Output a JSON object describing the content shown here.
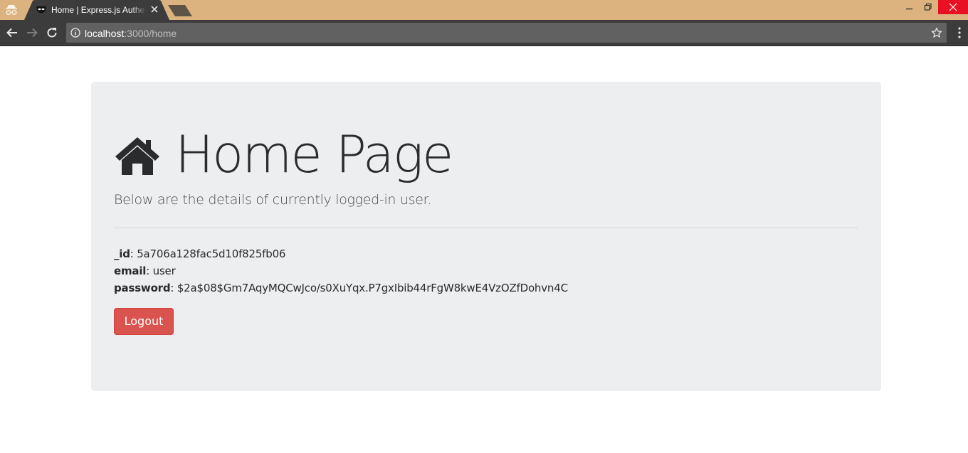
{
  "browser": {
    "tab_title": "Home | Express.js Authentication",
    "url_host": "localhost",
    "url_path": ":3000/home",
    "colors": {
      "frame": "#dcb27f",
      "toolbar": "#3c3c3c",
      "omnibox": "#616161",
      "close": "#e81123"
    },
    "icons": [
      "incognito-icon",
      "favicon-icon",
      "tab-close-icon",
      "new-tab-icon",
      "minimize-icon",
      "restore-icon",
      "window-close-icon",
      "back-icon",
      "forward-icon",
      "reload-icon",
      "info-icon",
      "bookmark-star-icon",
      "menu-icon"
    ]
  },
  "page": {
    "title": "Home Page",
    "title_icon": "home-icon",
    "lead": "Below are the details of currently logged-in user.",
    "user": {
      "id_label": "_id",
      "id_value": ": 5a706a128fac5d10f825fb06",
      "email_label": "email",
      "email_value": ": user",
      "password_label": "password",
      "password_value": ": $2a$08$Gm7AqyMQCwJco/s0XuYqx.P7gxIbib44rFgW8kwE4VzOZfDohvn4C"
    },
    "logout_label": "Logout",
    "colors": {
      "jumbotron": "#eceeef",
      "danger": "#d9534f",
      "text": "#292b2c"
    }
  }
}
